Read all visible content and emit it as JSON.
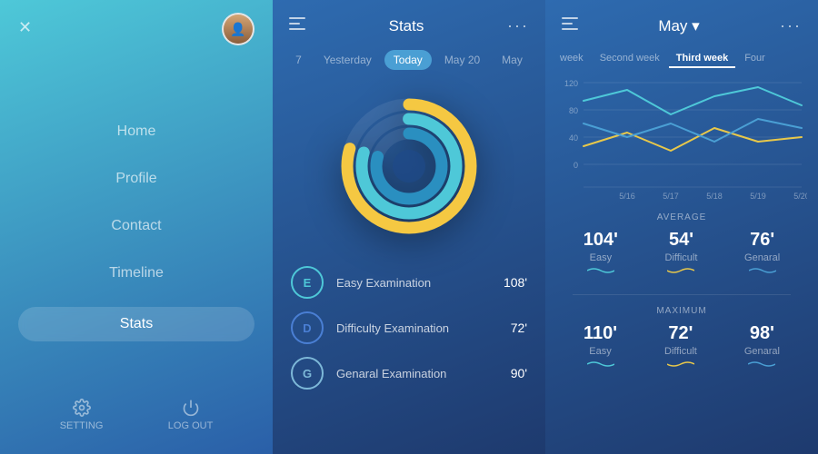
{
  "leftPanel": {
    "closeLabel": "✕",
    "navItems": [
      {
        "label": "Home",
        "active": false
      },
      {
        "label": "Profile",
        "active": false
      },
      {
        "label": "Contact",
        "active": false
      },
      {
        "label": "Timeline",
        "active": false
      },
      {
        "label": "Stats",
        "active": true
      }
    ],
    "bottomActions": [
      {
        "label": "SETTING",
        "icon": "gear"
      },
      {
        "label": "LOG OUT",
        "icon": "power"
      }
    ]
  },
  "midPanel": {
    "title": "Stats",
    "tabs": [
      {
        "label": "7",
        "active": false
      },
      {
        "label": "Yesterday",
        "active": false
      },
      {
        "label": "Today",
        "active": true
      },
      {
        "label": "May 20",
        "active": false
      },
      {
        "label": "May",
        "active": false
      }
    ],
    "donut": {
      "rings": [
        {
          "color": "#f5c842",
          "radius": 70,
          "stroke": 12,
          "offset": 30
        },
        {
          "color": "#4ec8d8",
          "radius": 54,
          "stroke": 12,
          "offset": 50
        },
        {
          "color": "#2a8fc0",
          "radius": 38,
          "stroke": 12,
          "offset": 60
        }
      ]
    },
    "exams": [
      {
        "badge": "E",
        "type": "easy",
        "label": "Easy Examination",
        "value": "108'"
      },
      {
        "badge": "D",
        "type": "diff",
        "label": "Difficulty Examination",
        "value": "72'"
      },
      {
        "badge": "G",
        "type": "gen",
        "label": "Genaral Examination",
        "value": "90'"
      }
    ]
  },
  "rightPanel": {
    "title": "May",
    "titleArrow": "▾",
    "weeks": [
      {
        "label": "week",
        "active": false
      },
      {
        "label": "Second week",
        "active": false
      },
      {
        "label": "Third week",
        "active": true
      },
      {
        "label": "Four",
        "active": false
      }
    ],
    "chartYLabels": [
      "120",
      "80",
      "40",
      "0"
    ],
    "chartXLabels": [
      "5/16",
      "5/17",
      "5/18",
      "5/19",
      "5/20"
    ],
    "sections": [
      {
        "title": "AVERAGE",
        "stats": [
          {
            "value": "104'",
            "label": "Easy",
            "wave": "easy"
          },
          {
            "value": "54'",
            "label": "Difficult",
            "wave": "diff"
          },
          {
            "value": "76'",
            "label": "Genaral",
            "wave": "gen"
          }
        ]
      },
      {
        "title": "MAXIMUM",
        "stats": [
          {
            "value": "110'",
            "label": "Easy",
            "wave": "easy"
          },
          {
            "value": "72'",
            "label": "Difficult",
            "wave": "diff"
          },
          {
            "value": "98'",
            "label": "Genaral",
            "wave": "gen"
          }
        ]
      }
    ]
  }
}
